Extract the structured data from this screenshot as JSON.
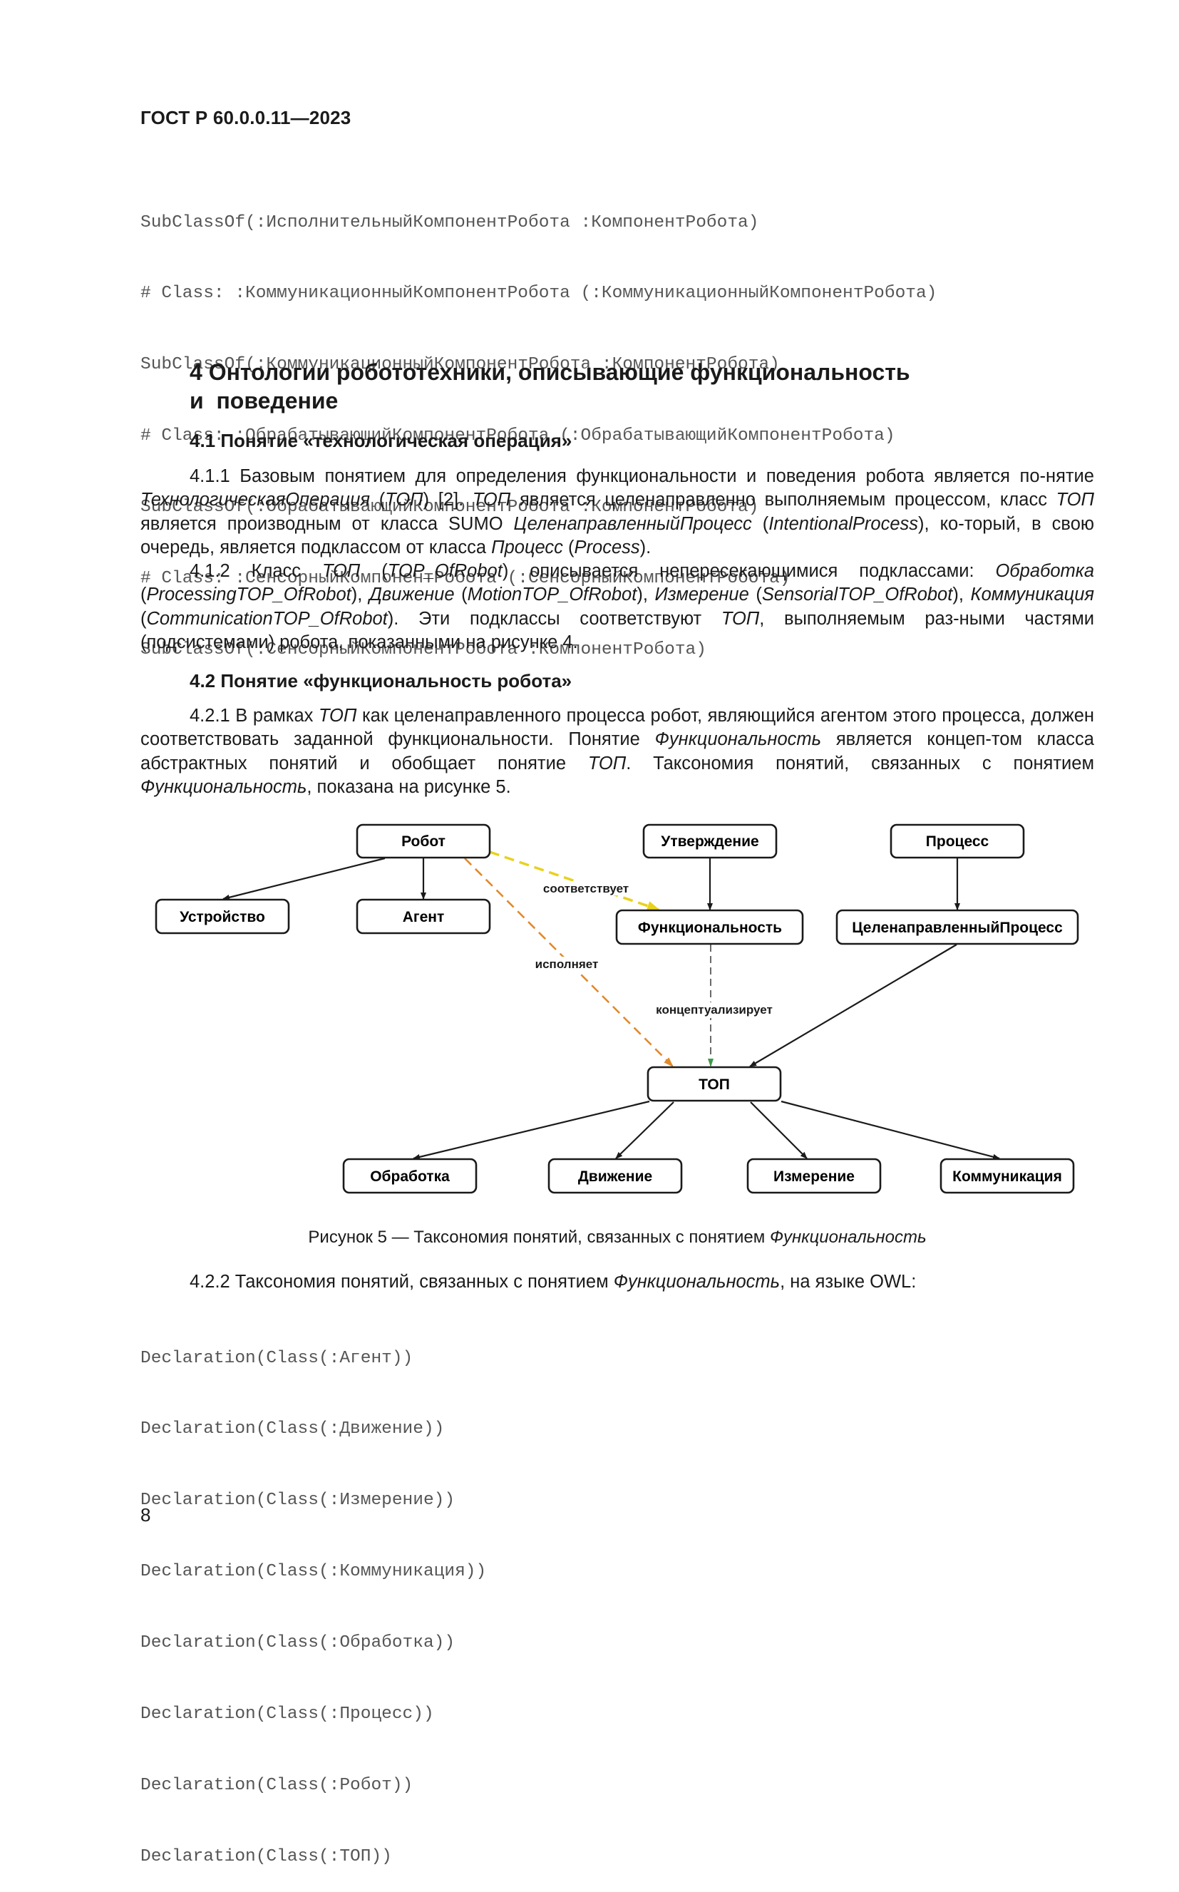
{
  "header": {
    "standard": "ГОСТ Р 60.0.0.11—2023"
  },
  "code_block_1": [
    "SubClassOf(:ИсполнительныйКомпонентРобота :КомпонентРобота)",
    "# Class: :КоммуникационныйКомпонентРобота (:КоммуникационныйКомпонентРобота)",
    "SubClassOf(:КоммуникационныйКомпонентРобота :КомпонентРобота)",
    "# Class: :ОбрабатывающийКомпонентРобота (:ОбрабатывающийКомпонентРобота)",
    "SubClassOf(:ОбрабатывающийКомпонентРобота :КомпонентРобота)",
    "# Class: :СенсорныйКомпонентРобота (:СенсорныйКомпонентРобота)",
    "SubClassOf(:СенсорныйКомпонентРобота :КомпонентРобота)"
  ],
  "section4": {
    "title_line1": "4 Онтологии робототехники, описывающие функциональность",
    "title_line2": "и  поведение",
    "s41": {
      "title": "4.1 Понятие «технологическая операция»",
      "p411": [
        {
          "t": "4.1.1 Базовым понятием для определения функциональности и поведения робота является по-нятие "
        },
        {
          "t": "ТехнологическаяОперация",
          "i": true
        },
        {
          "t": " ("
        },
        {
          "t": "ТОП",
          "i": true
        },
        {
          "t": ") [2]. "
        },
        {
          "t": "ТОП",
          "i": true
        },
        {
          "t": " является целенаправленно выполняемым процессом, класс "
        },
        {
          "t": "ТОП",
          "i": true
        },
        {
          "t": " является производным от класса SUMO "
        },
        {
          "t": "ЦеленаправленныйПроцесс",
          "i": true
        },
        {
          "t": " ("
        },
        {
          "t": "IntentionalProcess",
          "i": true
        },
        {
          "t": "), ко-торый, в свою очередь, является подклассом от класса "
        },
        {
          "t": "Процесс",
          "i": true
        },
        {
          "t": " ("
        },
        {
          "t": "Process",
          "i": true
        },
        {
          "t": ")."
        }
      ],
      "p412": [
        {
          "t": "4.1.2 Класс "
        },
        {
          "t": "ТОП",
          "i": true
        },
        {
          "t": " ("
        },
        {
          "t": "TOP_OfRobot",
          "i": true
        },
        {
          "t": ") описывается непересекающимися подклассами: "
        },
        {
          "t": "Обработка",
          "i": true
        },
        {
          "t": " ("
        },
        {
          "t": "ProcessingTOP_OfRobot",
          "i": true
        },
        {
          "t": "), "
        },
        {
          "t": "Движение",
          "i": true
        },
        {
          "t": " ("
        },
        {
          "t": "MotionTOP_OfRobot",
          "i": true
        },
        {
          "t": "), "
        },
        {
          "t": "Измерение",
          "i": true
        },
        {
          "t": " ("
        },
        {
          "t": "SensorialTOP_OfRobot",
          "i": true
        },
        {
          "t": "), "
        },
        {
          "t": "Коммуникация",
          "i": true
        },
        {
          "t": " ("
        },
        {
          "t": "CommunicationTOP_OfRobot",
          "i": true
        },
        {
          "t": "). Эти подклассы соответствуют "
        },
        {
          "t": "ТОП",
          "i": true
        },
        {
          "t": ", выполняемым раз-ными частями (подсистемами) робота, показанными на рисунке 4."
        }
      ]
    },
    "s42": {
      "title": "4.2 Понятие «функциональность робота»",
      "p421": [
        {
          "t": "4.2.1 В рамках "
        },
        {
          "t": "ТОП",
          "i": true
        },
        {
          "t": " как целенаправленного процесса робот, являющийся агентом этого процесса, должен соответствовать заданной функциональности. Понятие "
        },
        {
          "t": "Функциональность",
          "i": true
        },
        {
          "t": " является концеп-том класса абстрактных понятий и обобщает понятие "
        },
        {
          "t": "ТОП",
          "i": true
        },
        {
          "t": ". Таксономия понятий, связанных с понятием "
        },
        {
          "t": "Функциональность",
          "i": true
        },
        {
          "t": ", показана на рисунке 5."
        }
      ],
      "p422": [
        {
          "t": "4.2.2 Таксономия понятий, связанных с понятием "
        },
        {
          "t": "Функциональность",
          "i": true
        },
        {
          "t": ", на языке OWL:"
        }
      ]
    }
  },
  "figure5": {
    "caption_prefix": "Рисунок 5 — Таксономия понятий, связанных с понятием ",
    "caption_italic": "Функциональность",
    "nodes": {
      "robot": "Робот",
      "device": "Устройство",
      "agent": "Агент",
      "statement": "Утверждение",
      "functionality": "Функциональность",
      "process": "Процесс",
      "intentional_process": "ЦеленаправленныйПроцесс",
      "top": "ТОП",
      "processing": "Обработка",
      "motion": "Движение",
      "measurement": "Измерение",
      "communication": "Коммуникация"
    },
    "edge_labels": {
      "corresponds": "соответствует",
      "executes": "исполняет",
      "conceptualizes": "концептуализирует"
    },
    "colors": {
      "corresponds": "#e8d21c",
      "executes": "#e08a2c",
      "conceptualizes": "#3f9a4a",
      "subclass": "#1a1a1a"
    }
  },
  "code_block_2": [
    "Declaration(Class(:Агент))",
    "Declaration(Class(:Движение))",
    "Declaration(Class(:Измерение))",
    "Declaration(Class(:Коммуникация))",
    "Declaration(Class(:Обработка))",
    "Declaration(Class(:Процесс))",
    "Declaration(Class(:Робот))",
    "Declaration(Class(:ТОП))"
  ],
  "footer": {
    "page_number": "8"
  }
}
